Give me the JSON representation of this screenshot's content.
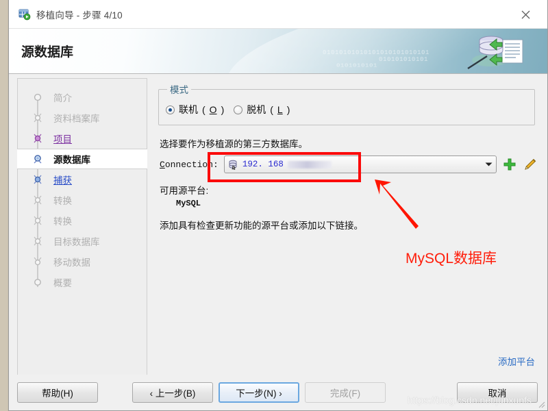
{
  "window": {
    "title": "移植向导 - 步骤 4/10",
    "icon": "migration-wizard-icon",
    "close_icon": "close-icon"
  },
  "banner": {
    "heading": "源数据库",
    "binary_a": "01010101010101010101010101",
    "binary_b": "010101010101",
    "binary_c": "0101010101",
    "art_icon": "database-migration-graphic"
  },
  "sidebar": {
    "steps": [
      {
        "label": "简介",
        "state": "done"
      },
      {
        "label": "资料档案库",
        "state": "done"
      },
      {
        "label": "项目",
        "state": "visited-link"
      },
      {
        "label": "源数据库",
        "state": "current"
      },
      {
        "label": "捕获",
        "state": "link"
      },
      {
        "label": "转换",
        "state": "pending"
      },
      {
        "label": "转换",
        "state": "pending"
      },
      {
        "label": "目标数据库",
        "state": "pending"
      },
      {
        "label": "移动数据",
        "state": "pending"
      },
      {
        "label": "概要",
        "state": "pending"
      }
    ]
  },
  "main": {
    "mode_group_legend": "模式",
    "radio_online_label": "联机",
    "radio_online_mnemonic": "O",
    "radio_offline_label": "脱机",
    "radio_offline_mnemonic": "L",
    "description": "选择要作为移植源的第三方数据库。",
    "connection_label_prefix": "C",
    "connection_label_rest": "onnection:",
    "connection_value": "192. 168",
    "connection_icon": "database-connection-icon",
    "dropdown_icon": "chevron-down-icon",
    "add_connection_icon": "plus-icon",
    "edit_connection_icon": "pencil-icon",
    "available_platforms_title": "可用源平台:",
    "available_platforms": [
      "MySQL"
    ],
    "add_platform_hint": "添加具有检查更新功能的源平台或添加以下链接。",
    "add_platform_link": "添加平台"
  },
  "footer": {
    "help": "帮助(H)",
    "back": "‹ 上一步(B)",
    "next": "下一步(N) ›",
    "finish": "完成(F)",
    "cancel": "取消"
  },
  "annotations": {
    "callout_text": "MySQL数据库",
    "callout_color": "#ff1d0a",
    "highlight_color": "#fb0a0a",
    "arrow_icon": "red-arrow-icon",
    "watermark": "https://blog.csdn.net/junxunfs"
  }
}
